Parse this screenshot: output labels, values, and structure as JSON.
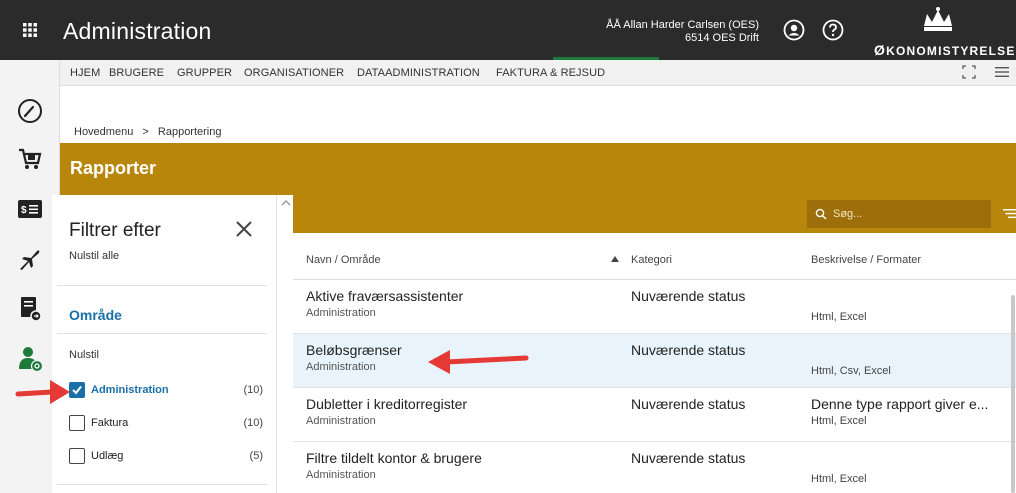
{
  "topbar": {
    "title": "Administration",
    "user_name": "ÅÅ Allan Harder Carlsen (OES)",
    "user_unit": "6514 OES Drift",
    "logo_text_first": "Ø",
    "logo_text_rest": "KONOMISTYRELSEN"
  },
  "nav": {
    "items": [
      "HJEM",
      "BRUGERE",
      "GRUPPER",
      "ORGANISATIONER",
      "DATAADMINISTRATION",
      "FAKTURA & REJSUD"
    ],
    "active": "FAKTURA & REJSUD"
  },
  "breadcrumb": {
    "home": "Hovedmenu",
    "separator": ">",
    "current": "Rapportering"
  },
  "section": {
    "title": "Rapporter"
  },
  "filter": {
    "title": "Filtrer efter",
    "reset_all": "Nulstil alle",
    "group": "Område",
    "reset": "Nulstil",
    "options": [
      {
        "label": "Administration",
        "count": "(10)",
        "checked": true
      },
      {
        "label": "Faktura",
        "count": "(10)",
        "checked": false
      },
      {
        "label": "Udlæg",
        "count": "(5)",
        "checked": false
      }
    ]
  },
  "search": {
    "placeholder": "Søg..."
  },
  "table": {
    "columns": [
      "Navn / Område",
      "Kategori",
      "Beskrivelse / Formater"
    ],
    "rows": [
      {
        "name": "Aktive fraværsassistenter",
        "area": "Administration",
        "category": "Nuværende status",
        "description": "",
        "formats": "Html, Excel"
      },
      {
        "name": "Beløbsgrænser",
        "area": "Administration",
        "category": "Nuværende status",
        "description": "",
        "formats": "Html, Csv, Excel"
      },
      {
        "name": "Dubletter i kreditorregister",
        "area": "Administration",
        "category": "Nuværende status",
        "description": "Denne type rapport giver e...",
        "formats": "Html, Excel"
      },
      {
        "name": "Filtre tildelt kontor & brugere",
        "area": "Administration",
        "category": "Nuværende status",
        "description": "",
        "formats": "Html, Excel"
      }
    ]
  },
  "colors": {
    "topbar": "#2b2b2b",
    "accent_gold": "#b8860b",
    "link_blue": "#1a6fa8",
    "active_green": "#1c7a3b",
    "annotation_red": "#e53935"
  },
  "icons": {
    "rail": [
      "speedometer-icon",
      "cart-icon",
      "money-list-icon",
      "plane-icon",
      "document-icon",
      "user-admin-icon"
    ]
  }
}
